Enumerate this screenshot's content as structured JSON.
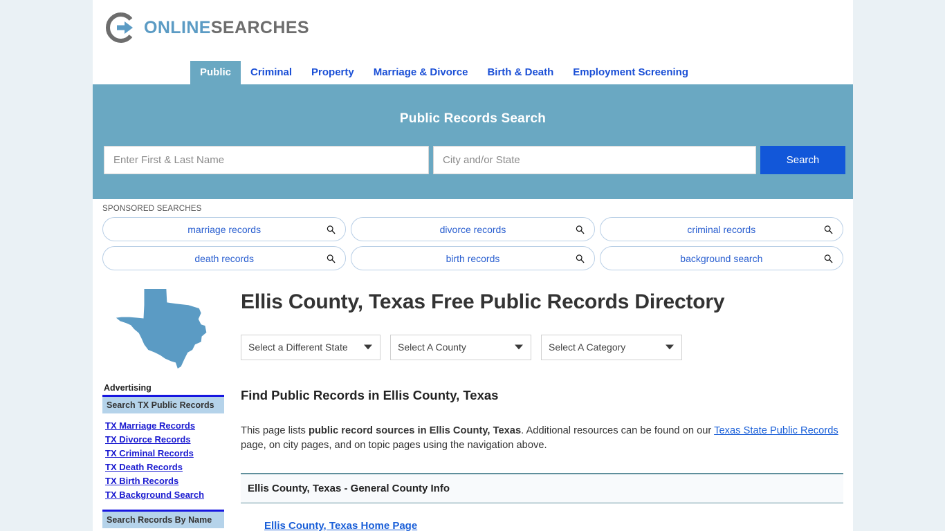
{
  "brand": {
    "logo_icon": "circular-arrow-logo-icon",
    "name_part1": "ONLINE",
    "name_part2": "SEARCHES",
    "color_blue": "#5b9bc4",
    "color_gray": "#6d6d6d"
  },
  "nav": {
    "items": [
      {
        "label": "Public",
        "active": true
      },
      {
        "label": "Criminal",
        "active": false
      },
      {
        "label": "Property",
        "active": false
      },
      {
        "label": "Marriage & Divorce",
        "active": false
      },
      {
        "label": "Birth & Death",
        "active": false
      },
      {
        "label": "Employment Screening",
        "active": false
      }
    ]
  },
  "hero": {
    "title": "Public Records Search",
    "name_placeholder": "Enter First & Last Name",
    "name_value": "",
    "location_placeholder": "City and/or State",
    "location_value": "",
    "search_button": "Search",
    "bg_color": "#6aa8c2",
    "button_color": "#1257d9"
  },
  "sponsored": {
    "label": "SPONSORED SEARCHES",
    "rows": [
      [
        {
          "label": "marriage records",
          "icon": "magnifier-icon"
        },
        {
          "label": "divorce records",
          "icon": "magnifier-icon"
        },
        {
          "label": "criminal records",
          "icon": "magnifier-icon"
        }
      ],
      [
        {
          "label": "death records",
          "icon": "magnifier-icon"
        },
        {
          "label": "birth records",
          "icon": "magnifier-icon"
        },
        {
          "label": "background search",
          "icon": "magnifier-icon"
        }
      ]
    ]
  },
  "sidebar": {
    "state_map_icon": "texas-state-map-icon",
    "state_map_color": "#5b9bc4",
    "advertising_label": "Advertising",
    "box1_title": "Search TX Public Records",
    "links": [
      {
        "label": "TX Marriage Records"
      },
      {
        "label": "TX Divorce Records"
      },
      {
        "label": "TX Criminal Records"
      },
      {
        "label": "TX Death Records"
      },
      {
        "label": "TX Birth Records"
      },
      {
        "label": "TX Background Search"
      }
    ],
    "box2_title": "Search Records By Name"
  },
  "main": {
    "page_title": "Ellis County, Texas Free Public Records Directory",
    "selects": [
      {
        "value": "Select a Different State",
        "caret": "chevron-down-icon"
      },
      {
        "value": "Select A County",
        "caret": "chevron-down-icon"
      },
      {
        "value": "Select A Category",
        "caret": "chevron-down-icon"
      }
    ],
    "section_heading": "Find Public Records in Ellis County, Texas",
    "intro": {
      "part1": "This page lists ",
      "bold1": "public record sources in Ellis County, Texas",
      "part2": ". Additional resources can be found on our ",
      "link1": "Texas State Public Records",
      "part3": " page, on city pages, and on topic pages using the navigation above."
    },
    "table_header": "Ellis County, Texas - General County Info",
    "first_row_link": "Ellis County, Texas Home Page"
  }
}
